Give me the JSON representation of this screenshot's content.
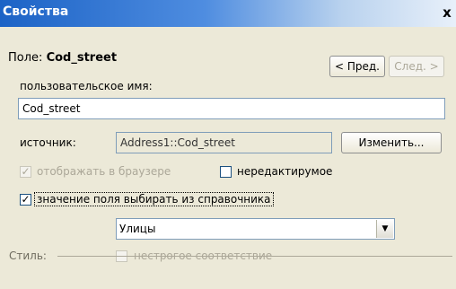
{
  "window": {
    "title": "Свойства",
    "close_glyph": "x"
  },
  "field": {
    "prefix": "Поле:",
    "name": "Cod_street"
  },
  "nav": {
    "prev_label": "< Пред.",
    "next_label": "След. >"
  },
  "user_name": {
    "label": "пользовательское имя:",
    "value": "Cod_street"
  },
  "source": {
    "label": "источник:",
    "value": "Address1::Cod_street",
    "change_label": "Изменить..."
  },
  "options": {
    "show_in_browser": {
      "label": "отображать в браузере",
      "checked": true,
      "disabled": true
    },
    "read_only": {
      "label": "нередактирумое",
      "checked": false
    },
    "from_reference": {
      "label": "значение поля выбирать из справочника",
      "checked": true
    }
  },
  "reference": {
    "selected": "Улицы",
    "arrow_glyph": "▼"
  },
  "loose_match": {
    "label": "нестрогое соответствие",
    "checked": false,
    "disabled": true
  },
  "style_section": {
    "label": "Стиль:"
  },
  "check_glyph": "✓"
}
